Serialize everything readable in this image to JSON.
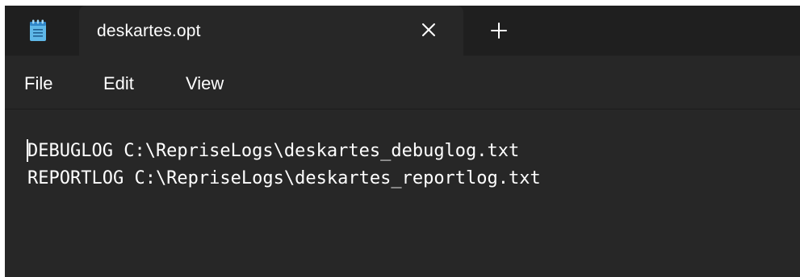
{
  "window": {
    "app_icon": "notepad-icon",
    "tab": {
      "title": "deskartes.opt",
      "close_icon": "close-icon"
    },
    "new_tab_icon": "plus-icon"
  },
  "menu": {
    "items": [
      {
        "label": "File"
      },
      {
        "label": "Edit"
      },
      {
        "label": "View"
      }
    ]
  },
  "editor": {
    "lines": [
      "DEBUGLOG C:\\RepriseLogs\\deskartes_debuglog.txt",
      "REPORTLOG C:\\RepriseLogs\\deskartes_reportlog.txt"
    ]
  },
  "colors": {
    "titlebar_bg": "#1f1f1f",
    "tab_bg": "#272727",
    "editor_bg": "#272727",
    "text": "#ffffff",
    "icon_accent": "#5fb8e8"
  }
}
